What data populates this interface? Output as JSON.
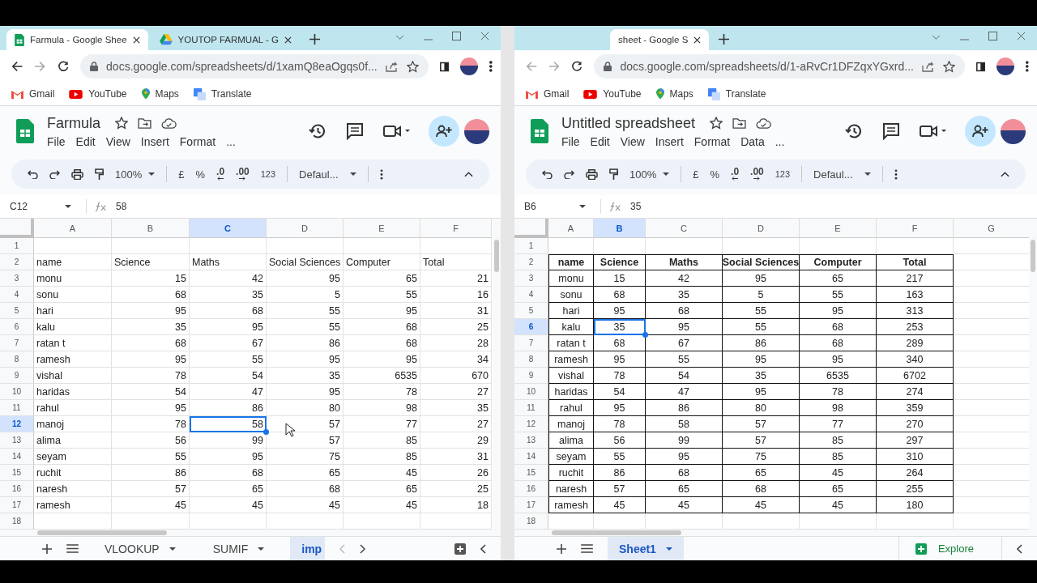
{
  "windows": [
    {
      "tabs": [
        {
          "title": "Farmula - Google Shee",
          "selected": true
        },
        {
          "title": "YOUTOP FARMUAL - G",
          "selected": false
        }
      ],
      "can_go_back": true,
      "url": "docs.google.com/spreadsheets/d/1xamQ8eaOgqs0f...",
      "bookmarks": [
        "Gmail",
        "YouTube",
        "Maps",
        "Translate"
      ],
      "doc_title": "Farmula",
      "menus": [
        "File",
        "Edit",
        "View",
        "Insert",
        "Format",
        "..."
      ],
      "toolbar": {
        "zoom": "100%",
        "currency": "£",
        "percent": "%",
        "decimals_less": ".0",
        "decimals_more": ".00",
        "number_format": "123",
        "font": "Defaul..."
      },
      "cell_ref": "C12",
      "formula": "58",
      "grid": {
        "kind": "plain",
        "columns": [
          {
            "label": "A",
            "selected": false
          },
          {
            "label": "B",
            "selected": false
          },
          {
            "label": "C",
            "selected": true
          },
          {
            "label": "D",
            "selected": false
          },
          {
            "label": "E",
            "selected": false
          },
          {
            "label": "F",
            "selected": false
          }
        ],
        "rows": [
          {
            "label": "1",
            "kind": "blank",
            "selected": false,
            "cells": []
          },
          {
            "label": "2",
            "kind": "header",
            "selected": false,
            "cells": [
              "name",
              "Science",
              "Maths",
              "Social Sciences",
              "Computer",
              "Total"
            ]
          },
          {
            "label": "3",
            "kind": "data",
            "selected": false,
            "cells": [
              "monu",
              "15",
              "42",
              "95",
              "65",
              "21"
            ]
          },
          {
            "label": "4",
            "kind": "data",
            "selected": false,
            "cells": [
              "sonu",
              "68",
              "35",
              "5",
              "55",
              "16"
            ]
          },
          {
            "label": "5",
            "kind": "data",
            "selected": false,
            "cells": [
              "hari",
              "95",
              "68",
              "55",
              "95",
              "31"
            ]
          },
          {
            "label": "6",
            "kind": "data",
            "selected": false,
            "cells": [
              "kalu",
              "35",
              "95",
              "55",
              "68",
              "25"
            ]
          },
          {
            "label": "7",
            "kind": "data",
            "selected": false,
            "cells": [
              "ratan t",
              "68",
              "67",
              "86",
              "68",
              "28"
            ]
          },
          {
            "label": "8",
            "kind": "data",
            "selected": false,
            "cells": [
              "ramesh",
              "95",
              "55",
              "95",
              "95",
              "34"
            ]
          },
          {
            "label": "9",
            "kind": "data",
            "selected": false,
            "cells": [
              "vishal",
              "78",
              "54",
              "35",
              "6535",
              "670"
            ]
          },
          {
            "label": "10",
            "kind": "data",
            "selected": false,
            "cells": [
              "haridas",
              "54",
              "47",
              "95",
              "78",
              "27"
            ]
          },
          {
            "label": "11",
            "kind": "data",
            "selected": false,
            "cells": [
              "rahul",
              "95",
              "86",
              "80",
              "98",
              "35"
            ]
          },
          {
            "label": "12",
            "kind": "data",
            "selected": true,
            "cells": [
              "manoj",
              "78",
              "58",
              "57",
              "77",
              "27"
            ]
          },
          {
            "label": "13",
            "kind": "data",
            "selected": false,
            "cells": [
              "alima",
              "56",
              "99",
              "57",
              "85",
              "29"
            ]
          },
          {
            "label": "14",
            "kind": "data",
            "selected": false,
            "cells": [
              "seyam",
              "55",
              "95",
              "75",
              "85",
              "31"
            ]
          },
          {
            "label": "15",
            "kind": "data",
            "selected": false,
            "cells": [
              "ruchit",
              "86",
              "68",
              "65",
              "45",
              "26"
            ]
          },
          {
            "label": "16",
            "kind": "data",
            "selected": false,
            "cells": [
              "naresh",
              "57",
              "65",
              "68",
              "65",
              "25"
            ]
          },
          {
            "label": "17",
            "kind": "data",
            "selected": false,
            "cells": [
              "ramesh",
              "45",
              "45",
              "45",
              "45",
              "18"
            ]
          },
          {
            "label": "18",
            "kind": "blank",
            "selected": false,
            "cells": []
          }
        ]
      },
      "sheets": [
        {
          "name": "VLOOKUP",
          "selected": false
        },
        {
          "name": "SUMIF",
          "selected": false
        },
        {
          "name": "imp",
          "selected": true
        }
      ],
      "mouse_pointer": true
    },
    {
      "tabs": [
        {
          "title": "sheet - Google S",
          "selected": true
        }
      ],
      "can_go_back": false,
      "url": "docs.google.com/spreadsheets/d/1-aRvCr1DFZqxYGxrd...",
      "bookmarks": [
        "Gmail",
        "YouTube",
        "Maps",
        "Translate"
      ],
      "doc_title": "Untitled spreadsheet",
      "menus": [
        "File",
        "Edit",
        "View",
        "Insert",
        "Format",
        "Data",
        "..."
      ],
      "toolbar": {
        "zoom": "100%",
        "currency": "£",
        "percent": "%",
        "decimals_less": ".0",
        "decimals_more": ".00",
        "number_format": "123",
        "font": "Defaul..."
      },
      "cell_ref": "B6",
      "formula": "35",
      "grid": {
        "kind": "bordered",
        "columns": [
          {
            "label": "A",
            "selected": false
          },
          {
            "label": "B",
            "selected": true
          },
          {
            "label": "C",
            "selected": false
          },
          {
            "label": "D",
            "selected": false
          },
          {
            "label": "E",
            "selected": false
          },
          {
            "label": "F",
            "selected": false
          },
          {
            "label": "G",
            "selected": false
          }
        ],
        "rows": [
          {
            "label": "1",
            "kind": "blank",
            "selected": false,
            "cells": []
          },
          {
            "label": "2",
            "kind": "header",
            "selected": false,
            "cells": [
              "name",
              "Science",
              "Maths",
              "Social Sciences",
              "Computer",
              "Total"
            ]
          },
          {
            "label": "3",
            "kind": "data",
            "selected": false,
            "cells": [
              "monu",
              "15",
              "42",
              "95",
              "65",
              "217"
            ]
          },
          {
            "label": "4",
            "kind": "data",
            "selected": false,
            "cells": [
              "sonu",
              "68",
              "35",
              "5",
              "55",
              "163"
            ]
          },
          {
            "label": "5",
            "kind": "data",
            "selected": false,
            "cells": [
              "hari",
              "95",
              "68",
              "55",
              "95",
              "313"
            ]
          },
          {
            "label": "6",
            "kind": "data",
            "selected": true,
            "cells": [
              "kalu",
              "35",
              "95",
              "55",
              "68",
              "253"
            ]
          },
          {
            "label": "7",
            "kind": "data",
            "selected": false,
            "cells": [
              "ratan t",
              "68",
              "67",
              "86",
              "68",
              "289"
            ]
          },
          {
            "label": "8",
            "kind": "data",
            "selected": false,
            "cells": [
              "ramesh",
              "95",
              "55",
              "95",
              "95",
              "340"
            ]
          },
          {
            "label": "9",
            "kind": "data",
            "selected": false,
            "cells": [
              "vishal",
              "78",
              "54",
              "35",
              "6535",
              "6702"
            ]
          },
          {
            "label": "10",
            "kind": "data",
            "selected": false,
            "cells": [
              "haridas",
              "54",
              "47",
              "95",
              "78",
              "274"
            ]
          },
          {
            "label": "11",
            "kind": "data",
            "selected": false,
            "cells": [
              "rahul",
              "95",
              "86",
              "80",
              "98",
              "359"
            ]
          },
          {
            "label": "12",
            "kind": "data",
            "selected": false,
            "cells": [
              "manoj",
              "78",
              "58",
              "57",
              "77",
              "270"
            ]
          },
          {
            "label": "13",
            "kind": "data",
            "selected": false,
            "cells": [
              "alima",
              "56",
              "99",
              "57",
              "85",
              "297"
            ]
          },
          {
            "label": "14",
            "kind": "data",
            "selected": false,
            "cells": [
              "seyam",
              "55",
              "95",
              "75",
              "85",
              "310"
            ]
          },
          {
            "label": "15",
            "kind": "data",
            "selected": false,
            "cells": [
              "ruchit",
              "86",
              "68",
              "65",
              "45",
              "264"
            ]
          },
          {
            "label": "16",
            "kind": "data",
            "selected": false,
            "cells": [
              "naresh",
              "57",
              "65",
              "68",
              "65",
              "255"
            ]
          },
          {
            "label": "17",
            "kind": "data",
            "selected": false,
            "cells": [
              "ramesh",
              "45",
              "45",
              "45",
              "45",
              "180"
            ]
          },
          {
            "label": "18",
            "kind": "blank",
            "selected": false,
            "cells": []
          }
        ]
      },
      "sheets": [
        {
          "name": "Sheet1",
          "selected": true
        }
      ],
      "explore": "Explore"
    }
  ]
}
